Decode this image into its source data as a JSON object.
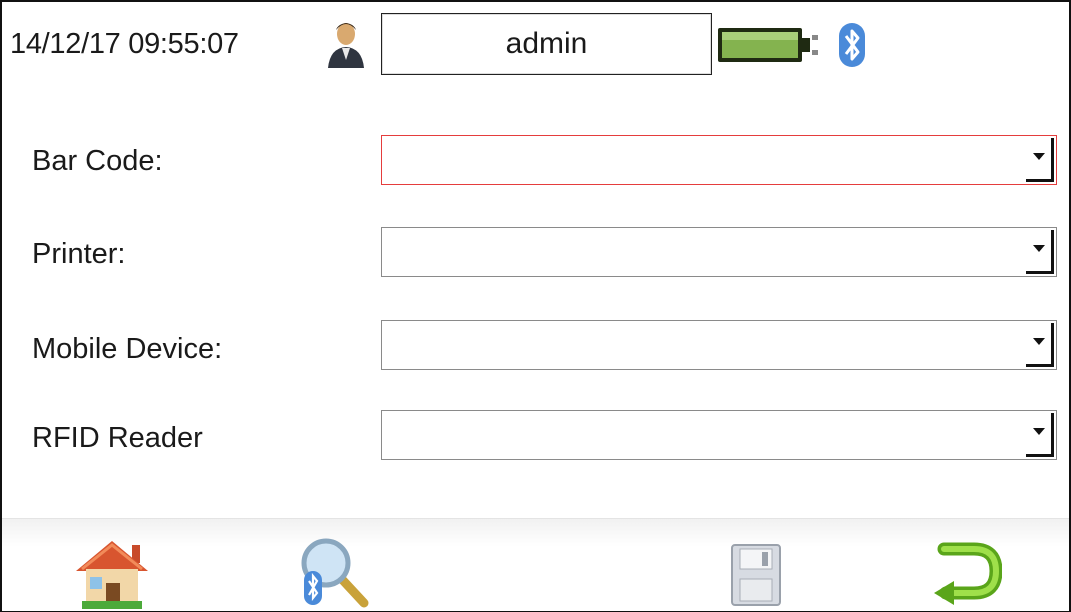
{
  "status_bar": {
    "datetime": "14/12/17 09:55:07",
    "user": "admin",
    "icons": [
      "user-icon",
      "battery-icon",
      "bluetooth-icon"
    ]
  },
  "form": {
    "fields": [
      {
        "label": "Bar Code:",
        "value": "",
        "active": true
      },
      {
        "label": "Printer:",
        "value": "",
        "active": false
      },
      {
        "label": "Mobile Device:",
        "value": "",
        "active": false
      },
      {
        "label": "RFID Reader",
        "value": "",
        "active": false
      }
    ]
  },
  "toolbar": {
    "icons": [
      "home-icon",
      "bluetooth-search-icon",
      "save-icon",
      "back-icon"
    ]
  },
  "colors": {
    "active_border": "#e53d3d",
    "battery": "#7fb04a",
    "bluetooth": "#3f7fd1",
    "back_arrow": "#6fbf1f"
  }
}
